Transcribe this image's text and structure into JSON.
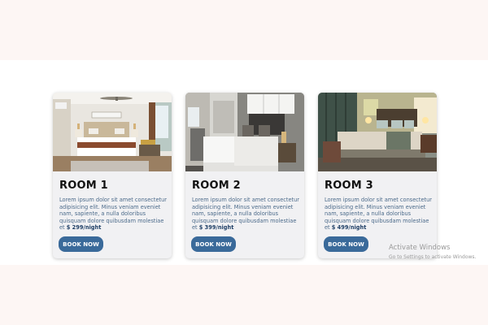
{
  "rooms": [
    {
      "title": "ROOM 1",
      "description": "Lorem ipsum dolor sit amet consectetur adipisicing elit. Minus veniam eveniet nam, sapiente, a nulla doloribus quisquam dolore quibusdam molestiae et",
      "price": "$ 299/night",
      "button_label": "BOOK NOW",
      "photo": "bedroom-photo"
    },
    {
      "title": "ROOM 2",
      "description": "Lorem ipsum dolor sit amet consectetur adipisicing elit. Minus veniam eveniet nam, sapiente, a nulla doloribus quisquam dolore quibusdam molestiae et",
      "price": "$ 399/night",
      "button_label": "BOOK NOW",
      "photo": "bedroom-photo"
    },
    {
      "title": "ROOM 3",
      "description": "Lorem ipsum dolor sit amet consectetur adipisicing elit. Minus veniam eveniet nam, sapiente, a nulla doloribus quisquam dolore quibusdam molestiae et",
      "price": "$ 499/night",
      "button_label": "BOOK NOW",
      "photo": "bedroom-photo"
    }
  ],
  "watermark": {
    "title": "Activate Windows",
    "subtitle": "Go to Settings to activate Windows."
  },
  "colors": {
    "page_background": "#fdf6f4",
    "section_background": "#ffffff",
    "card_background": "#f1f1f3",
    "button": "#3a6a9a",
    "price": "#1f3f66",
    "description_text": "#4b6a8a"
  }
}
